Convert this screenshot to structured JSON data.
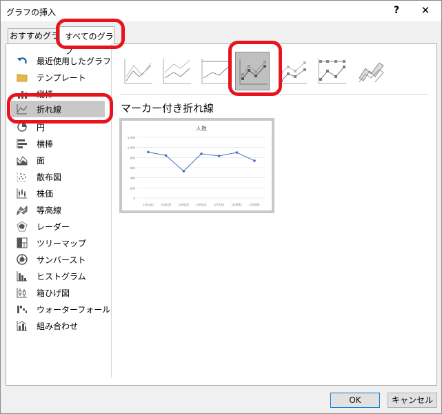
{
  "window": {
    "title": "グラフの挿入",
    "help": "?",
    "close": "✕"
  },
  "tabs": [
    {
      "label": "おすすめグラフ"
    },
    {
      "label": "すべてのグラフ"
    }
  ],
  "sidebar": {
    "items": [
      {
        "label": "最近使用したグラフ",
        "icon": "undo-arrow-icon"
      },
      {
        "label": "テンプレート",
        "icon": "folder-icon"
      },
      {
        "label": "縦棒",
        "icon": "column-chart-icon"
      },
      {
        "label": "折れ線",
        "icon": "line-chart-icon"
      },
      {
        "label": "円",
        "icon": "pie-chart-icon"
      },
      {
        "label": "横棒",
        "icon": "bar-chart-icon"
      },
      {
        "label": "面",
        "icon": "area-chart-icon"
      },
      {
        "label": "散布図",
        "icon": "scatter-chart-icon"
      },
      {
        "label": "株価",
        "icon": "stock-chart-icon"
      },
      {
        "label": "等高線",
        "icon": "surface-chart-icon"
      },
      {
        "label": "レーダー",
        "icon": "radar-chart-icon"
      },
      {
        "label": "ツリーマップ",
        "icon": "treemap-chart-icon"
      },
      {
        "label": "サンバースト",
        "icon": "sunburst-chart-icon"
      },
      {
        "label": "ヒストグラム",
        "icon": "histogram-chart-icon"
      },
      {
        "label": "箱ひげ図",
        "icon": "box-whisker-chart-icon"
      },
      {
        "label": "ウォーターフォール",
        "icon": "waterfall-chart-icon"
      },
      {
        "label": "組み合わせ",
        "icon": "combo-chart-icon"
      }
    ],
    "selected": "折れ線"
  },
  "subtypes": {
    "selected_index": 3,
    "selected_name": "マーカー付き折れ線"
  },
  "preview": {
    "chart_data": {
      "type": "line",
      "title": "人数",
      "categories": [
        "1/24(土)",
        "1/24(日)",
        "1/26(月)",
        "1/26(火)",
        "1/27(水)",
        "1/28(木)",
        "1/29(金)"
      ],
      "values": [
        1060,
        980,
        620,
        1020,
        970,
        1050,
        860
      ],
      "yticks": [
        "1,000",
        "1,000",
        "800",
        "600",
        "400",
        "200",
        "0"
      ],
      "ylim": [
        0,
        1400
      ],
      "grid": true,
      "markers": true,
      "color": "#4472c4"
    }
  },
  "buttons": {
    "ok": "OK",
    "cancel": "キャンセル"
  },
  "colors": {
    "highlight": "#e8141d",
    "selected_bg": "#c8c8c8",
    "accent": "#0078d7"
  }
}
